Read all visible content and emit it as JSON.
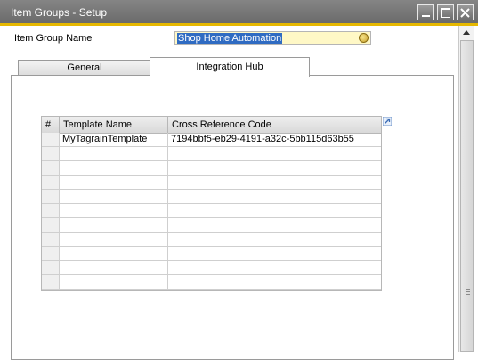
{
  "window": {
    "title": "Item Groups - Setup"
  },
  "form": {
    "item_group_name_label": "Item Group Name",
    "item_group_name_value": "Shop Home Automation"
  },
  "tabs": [
    {
      "label": "General",
      "active": false
    },
    {
      "label": "Integration Hub",
      "active": true
    }
  ],
  "grid": {
    "columns": [
      "#",
      "Template Name",
      "Cross Reference Code"
    ],
    "rows": [
      {
        "num": "",
        "template": "MyTagrainTemplate",
        "xref": "7194bbf5-eb29-4191-a32c-5bb115d63b55"
      },
      {
        "num": "",
        "template": "",
        "xref": ""
      },
      {
        "num": "",
        "template": "",
        "xref": ""
      },
      {
        "num": "",
        "template": "",
        "xref": ""
      },
      {
        "num": "",
        "template": "",
        "xref": ""
      },
      {
        "num": "",
        "template": "",
        "xref": ""
      },
      {
        "num": "",
        "template": "",
        "xref": ""
      },
      {
        "num": "",
        "template": "",
        "xref": ""
      },
      {
        "num": "",
        "template": "",
        "xref": ""
      },
      {
        "num": "",
        "template": "",
        "xref": ""
      },
      {
        "num": "",
        "template": "",
        "xref": ""
      }
    ]
  },
  "icons": {
    "link": "link-arrow-icon",
    "expand": "expand-arrow-icon"
  },
  "colors": {
    "title_bar": "#6b6b6b",
    "title_accent": "#e6b800",
    "field_background": "#fff8c6",
    "selection": "#2f6bc2"
  }
}
